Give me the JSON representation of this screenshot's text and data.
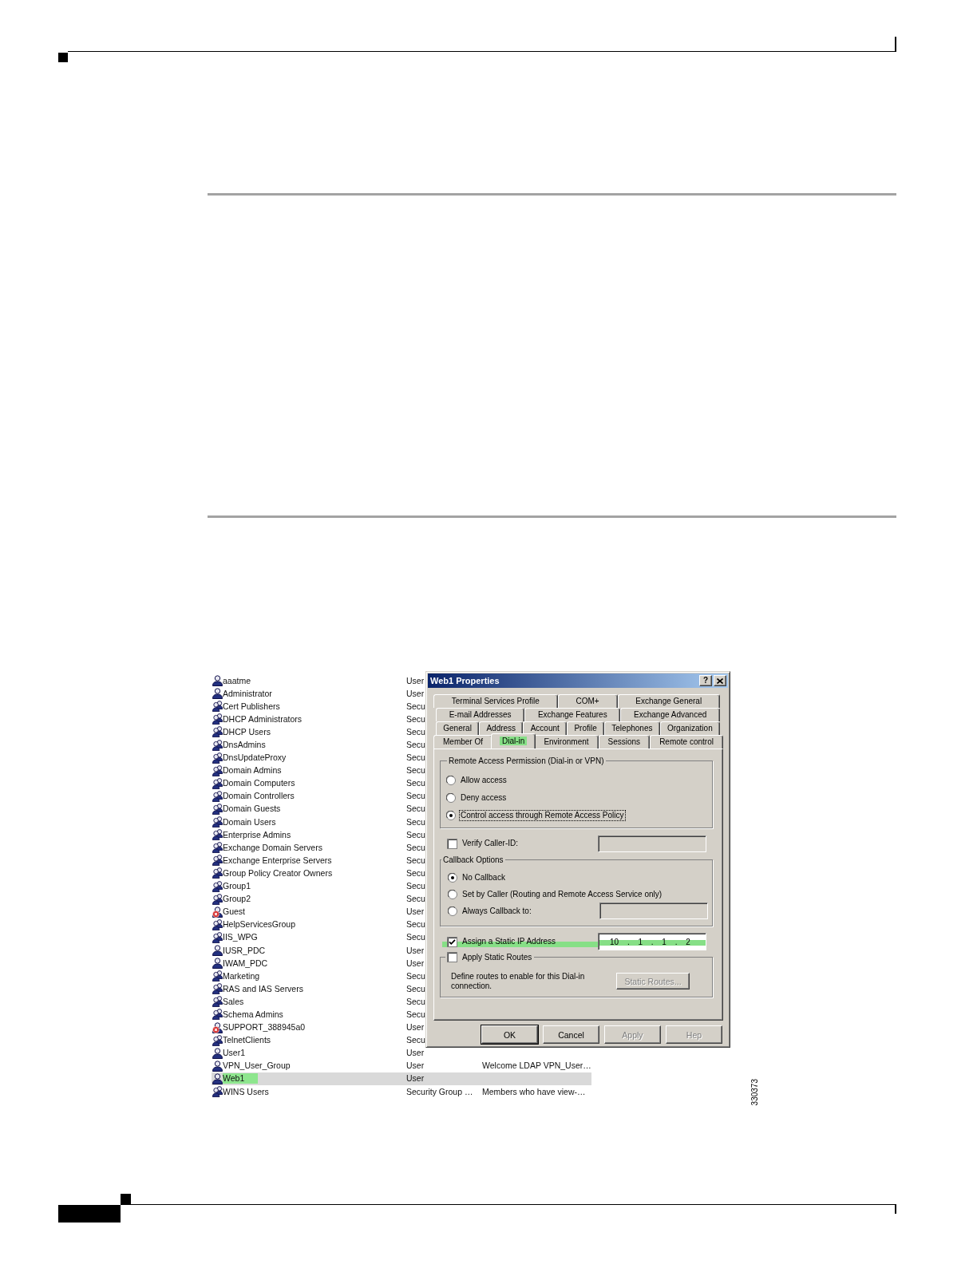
{
  "page": {
    "figure_number": "330373"
  },
  "account_list": {
    "rows": [
      {
        "name": "aaatme",
        "type": "User",
        "kind": "user",
        "selected": false,
        "highlighted": false
      },
      {
        "name": "Administrator",
        "type": "User",
        "kind": "user",
        "selected": false,
        "highlighted": false
      },
      {
        "name": "Cert Publishers",
        "type": "Secu",
        "kind": "group",
        "selected": false,
        "highlighted": false
      },
      {
        "name": "DHCP Administrators",
        "type": "Secu",
        "kind": "group",
        "selected": false,
        "highlighted": false
      },
      {
        "name": "DHCP Users",
        "type": "Secu",
        "kind": "group",
        "selected": false,
        "highlighted": false
      },
      {
        "name": "DnsAdmins",
        "type": "Secu",
        "kind": "group",
        "selected": false,
        "highlighted": false
      },
      {
        "name": "DnsUpdateProxy",
        "type": "Secu",
        "kind": "group",
        "selected": false,
        "highlighted": false
      },
      {
        "name": "Domain Admins",
        "type": "Secu",
        "kind": "group",
        "selected": false,
        "highlighted": false
      },
      {
        "name": "Domain Computers",
        "type": "Secu",
        "kind": "group",
        "selected": false,
        "highlighted": false
      },
      {
        "name": "Domain Controllers",
        "type": "Secu",
        "kind": "group",
        "selected": false,
        "highlighted": false
      },
      {
        "name": "Domain Guests",
        "type": "Secu",
        "kind": "group",
        "selected": false,
        "highlighted": false
      },
      {
        "name": "Domain Users",
        "type": "Secu",
        "kind": "group",
        "selected": false,
        "highlighted": false
      },
      {
        "name": "Enterprise Admins",
        "type": "Secu",
        "kind": "group",
        "selected": false,
        "highlighted": false
      },
      {
        "name": "Exchange Domain Servers",
        "type": "Secu",
        "kind": "group",
        "selected": false,
        "highlighted": false
      },
      {
        "name": "Exchange Enterprise Servers",
        "type": "Secu",
        "kind": "group",
        "selected": false,
        "highlighted": false
      },
      {
        "name": "Group Policy Creator Owners",
        "type": "Secu",
        "kind": "group",
        "selected": false,
        "highlighted": false
      },
      {
        "name": "Group1",
        "type": "Secu",
        "kind": "group",
        "selected": false,
        "highlighted": false
      },
      {
        "name": "Group2",
        "type": "Secu",
        "kind": "group",
        "selected": false,
        "highlighted": false
      },
      {
        "name": "Guest",
        "type": "User",
        "kind": "disabled_user",
        "selected": false,
        "highlighted": false
      },
      {
        "name": "HelpServicesGroup",
        "type": "Secu",
        "kind": "group",
        "selected": false,
        "highlighted": false
      },
      {
        "name": "IIS_WPG",
        "type": "Secu",
        "kind": "group",
        "selected": false,
        "highlighted": false
      },
      {
        "name": "IUSR_PDC",
        "type": "User",
        "kind": "user",
        "selected": false,
        "highlighted": false
      },
      {
        "name": "IWAM_PDC",
        "type": "User",
        "kind": "user",
        "selected": false,
        "highlighted": false
      },
      {
        "name": "Marketing",
        "type": "Secu",
        "kind": "group",
        "selected": false,
        "highlighted": false
      },
      {
        "name": "RAS and IAS Servers",
        "type": "Secu",
        "kind": "group",
        "selected": false,
        "highlighted": false
      },
      {
        "name": "Sales",
        "type": "Secu",
        "kind": "group",
        "selected": false,
        "highlighted": false
      },
      {
        "name": "Schema Admins",
        "type": "Secu",
        "kind": "group",
        "selected": false,
        "highlighted": false
      },
      {
        "name": "SUPPORT_388945a0",
        "type": "User",
        "kind": "disabled_user",
        "selected": false,
        "highlighted": false
      },
      {
        "name": "TelnetClients",
        "type": "Secu",
        "kind": "group",
        "selected": false,
        "highlighted": false
      },
      {
        "name": "User1",
        "type": "User",
        "kind": "user",
        "selected": false,
        "highlighted": false
      },
      {
        "name": "VPN_User_Group",
        "type": "User",
        "description": "Welcome LDAP VPN_User…",
        "kind": "user",
        "selected": false,
        "highlighted": false
      },
      {
        "name": "Web1",
        "type": "User",
        "kind": "user",
        "selected": true,
        "highlighted": true
      },
      {
        "name": "WINS Users",
        "type": "Security Group …",
        "description": "Members who have view-…",
        "kind": "group",
        "selected": false,
        "highlighted": false
      }
    ]
  },
  "dialog": {
    "title": "Web1 Properties",
    "help_button": "?",
    "tab_rows": [
      [
        {
          "label": "Terminal Services Profile",
          "selected": false,
          "highlighted": false
        },
        {
          "label": "COM+",
          "selected": false,
          "highlighted": false
        },
        {
          "label": "Exchange General",
          "selected": false,
          "highlighted": false
        }
      ],
      [
        {
          "label": "E-mail Addresses",
          "selected": false,
          "highlighted": false
        },
        {
          "label": "Exchange Features",
          "selected": false,
          "highlighted": false
        },
        {
          "label": "Exchange Advanced",
          "selected": false,
          "highlighted": false
        }
      ],
      [
        {
          "label": "General",
          "selected": false,
          "highlighted": false
        },
        {
          "label": "Address",
          "selected": false,
          "highlighted": false
        },
        {
          "label": "Account",
          "selected": false,
          "highlighted": false
        },
        {
          "label": "Profile",
          "selected": false,
          "highlighted": false
        },
        {
          "label": "Telephones",
          "selected": false,
          "highlighted": false
        },
        {
          "label": "Organization",
          "selected": false,
          "highlighted": false
        }
      ],
      [
        {
          "label": "Member Of",
          "selected": false,
          "highlighted": false
        },
        {
          "label": "Dial-in",
          "selected": true,
          "highlighted": true
        },
        {
          "label": "Environment",
          "selected": false,
          "highlighted": false
        },
        {
          "label": "Sessions",
          "selected": false,
          "highlighted": false
        },
        {
          "label": "Remote control",
          "selected": false,
          "highlighted": false
        }
      ]
    ],
    "remote_access": {
      "title": "Remote Access Permission (Dial-in or VPN)",
      "options": [
        {
          "label": "Allow access",
          "selected": false,
          "focused": false
        },
        {
          "label": "Deny access",
          "selected": false,
          "focused": false
        },
        {
          "label": "Control access through Remote Access Policy",
          "selected": true,
          "focused": true
        }
      ]
    },
    "verify_caller_id": {
      "label": "Verify Caller-ID:",
      "checked": false,
      "field": {
        "disabled": true
      }
    },
    "callback": {
      "title": "Callback Options",
      "options": [
        {
          "label": "No Callback",
          "selected": true
        },
        {
          "label": "Set by Caller (Routing and Remote Access Service only)",
          "selected": false
        },
        {
          "label": "Always Callback to:",
          "selected": false,
          "field": {
            "disabled": true
          }
        }
      ]
    },
    "static_ip": {
      "label": "Assign a Static IP Address",
      "checked": true,
      "highlighted": true,
      "value": "10 . 1 . 1 . 2"
    },
    "static_routes": {
      "label": "Apply Static Routes",
      "checked": false,
      "description": "Define routes to enable for this Dial-in connection.",
      "button": {
        "label": "Static Routes...",
        "disabled": true
      }
    },
    "buttons": [
      {
        "label": "OK",
        "default": true,
        "disabled": false
      },
      {
        "label": "Cancel",
        "default": false,
        "disabled": false
      },
      {
        "label": "Apply",
        "default": false,
        "disabled": true
      },
      {
        "label": "Hep",
        "default": false,
        "disabled": true
      }
    ]
  }
}
